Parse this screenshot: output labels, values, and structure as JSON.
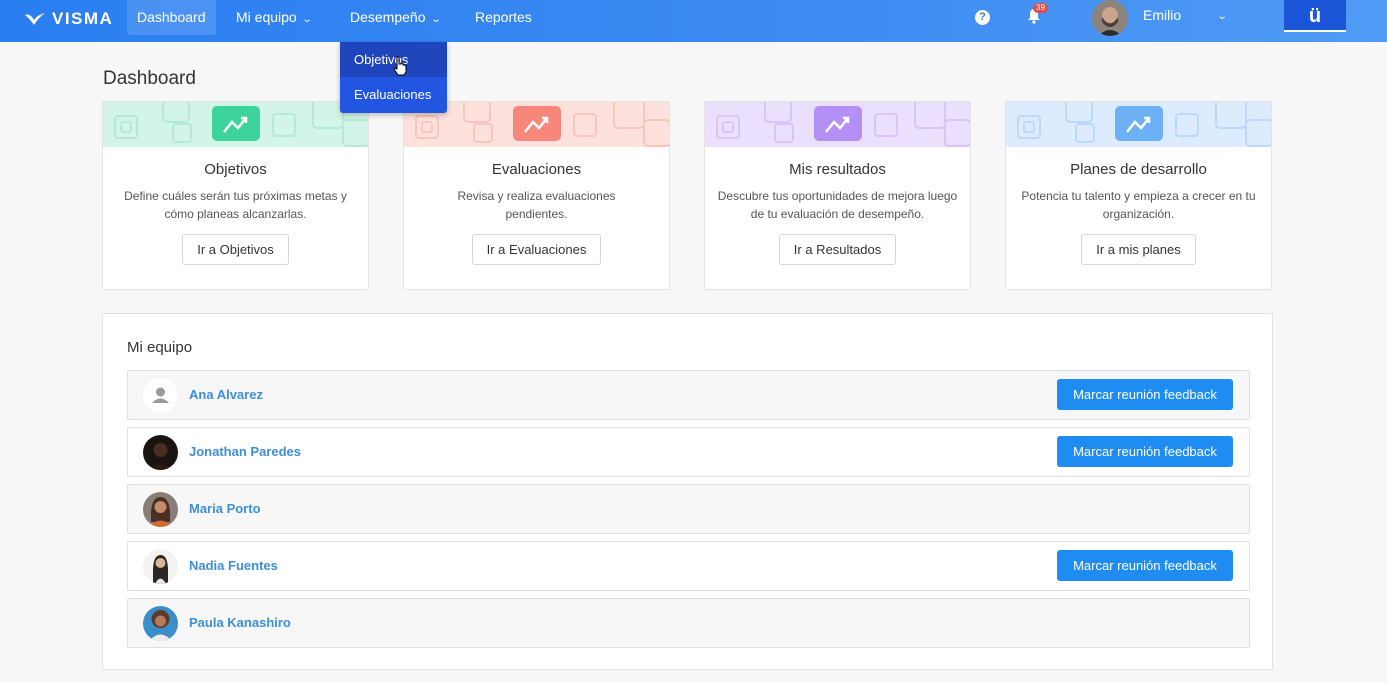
{
  "nav": {
    "logo": "VISMA",
    "items": [
      {
        "label": "Dashboard"
      },
      {
        "label": "Mi equipo"
      },
      {
        "label": "Desempeño"
      },
      {
        "label": "Reportes"
      }
    ],
    "help": "?",
    "notifications_count": "39",
    "user_name": "Emilio",
    "app_letter": "ü"
  },
  "dropdown": {
    "items": [
      {
        "label": "Objetivos"
      },
      {
        "label": "Evaluaciones"
      }
    ]
  },
  "page_title": "Dashboard",
  "cards": [
    {
      "title": "Objetivos",
      "desc_line1": "Define cuáles serán tus próximas metas y",
      "desc_line2": "cómo planeas alcanzarlas.",
      "button": "Ir a Objetivos",
      "color": "#d3f5e8",
      "icon_color": "#3ed29c"
    },
    {
      "title": "Evaluaciones",
      "desc_line1": "Revisa y realiza evaluaciones",
      "desc_line2": "pendientes.",
      "button": "Ir a Evaluaciones",
      "color": "#fde1dc",
      "icon_color": "#f7877a"
    },
    {
      "title": "Mis resultados",
      "desc_line1": "Descubre tus oportunidades de mejora luego",
      "desc_line2": "de tu evaluación de desempeño.",
      "button": "Ir a Resultados",
      "color": "#eadffc",
      "icon_color": "#b48ff5"
    },
    {
      "title": "Planes de desarrollo",
      "desc_line1": "Potencia tu talento y empieza a crecer en tu",
      "desc_line2": "organización.",
      "button": "Ir a mis planes",
      "color": "#dcebfd",
      "icon_color": "#6cb0f5"
    }
  ],
  "team": {
    "title": "Mi equipo",
    "button_label": "Marcar reunión feedback",
    "members": [
      {
        "name": "Ana Alvarez"
      },
      {
        "name": "Jonathan Paredes"
      },
      {
        "name": "Maria Porto"
      },
      {
        "name": "Nadia Fuentes"
      },
      {
        "name": "Paula Kanashiro"
      }
    ]
  }
}
